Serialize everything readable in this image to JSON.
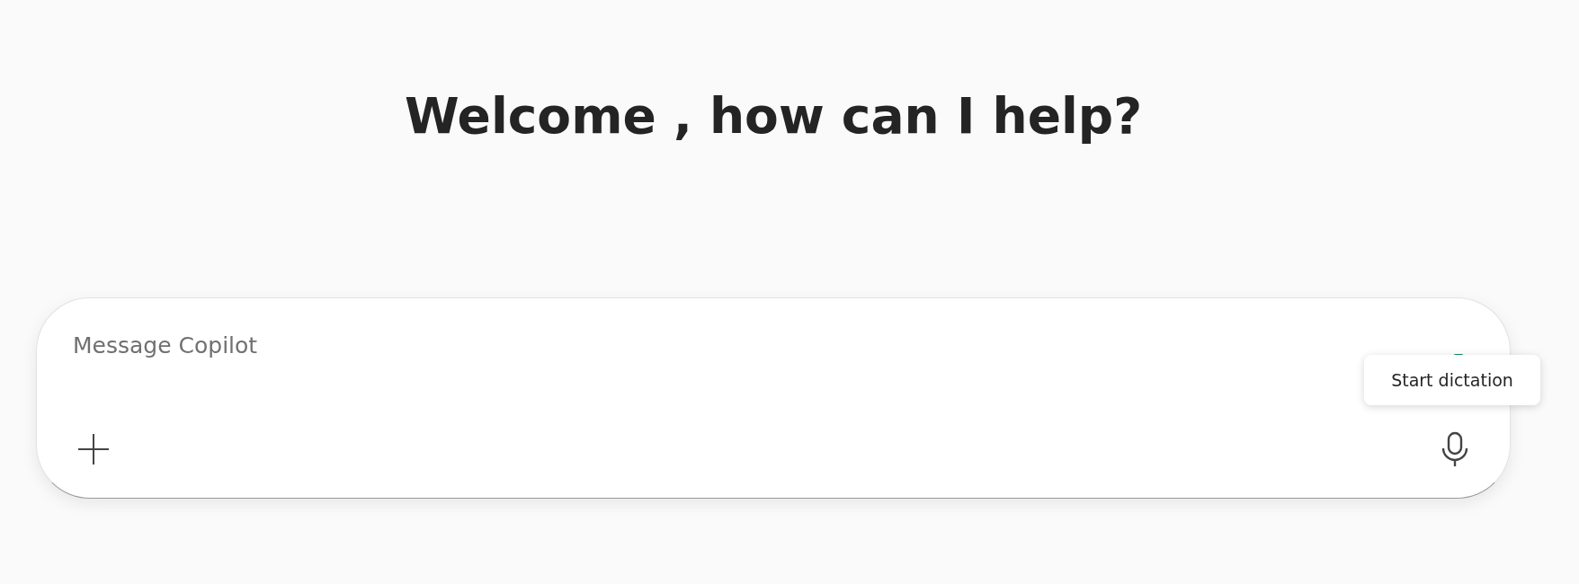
{
  "heading": "Welcome , how can I help?",
  "composer": {
    "placeholder": "Message Copilot"
  },
  "tooltip": {
    "text": "Start dictation"
  }
}
